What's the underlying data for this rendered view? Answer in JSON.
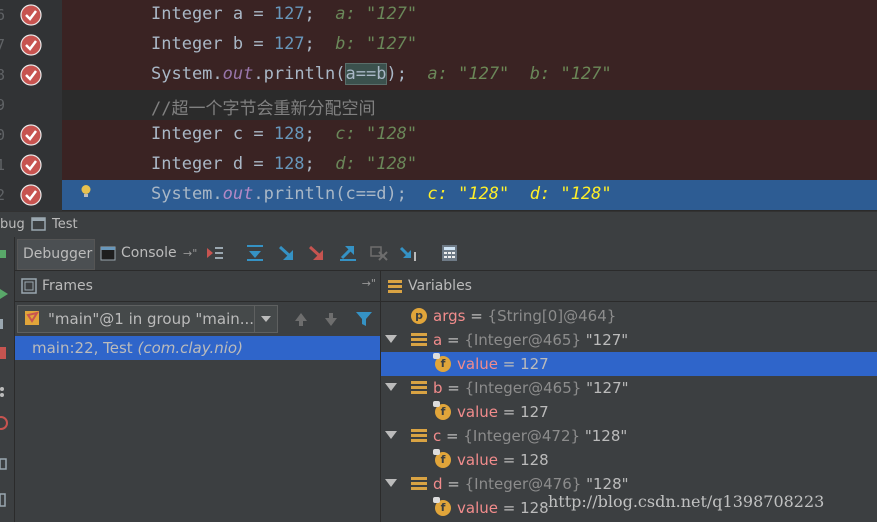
{
  "editor": {
    "lines": [
      {
        "num": "6",
        "code_parts": [
          [
            "Integer a = ",
            "kw"
          ],
          [
            "127",
            "num"
          ],
          [
            ";  ",
            "kw"
          ],
          [
            "a: \"127\"",
            "hint"
          ]
        ],
        "type": "bp"
      },
      {
        "num": "7",
        "code_parts": [
          [
            "Integer b = ",
            "kw"
          ],
          [
            "127",
            "num"
          ],
          [
            ";  ",
            "kw"
          ],
          [
            "b: \"127\"",
            "hint"
          ]
        ],
        "type": "bp"
      },
      {
        "num": "8",
        "code_parts": [
          [
            "System.",
            "kw"
          ],
          [
            "out",
            "field"
          ],
          [
            ".println(",
            "kw"
          ],
          [
            "a==b",
            "box"
          ],
          [
            ");  ",
            "kw"
          ],
          [
            "a: \"127\"  b: \"127\"",
            "hint"
          ]
        ],
        "type": "bp"
      },
      {
        "num": "9",
        "code_parts": [
          [
            "//超一个字节会重新分配空间",
            "cmt"
          ]
        ],
        "type": "comment"
      },
      {
        "num": "0",
        "code_parts": [
          [
            "Integer c = ",
            "kw"
          ],
          [
            "128",
            "num"
          ],
          [
            ";  ",
            "kw"
          ],
          [
            "c: \"128\"",
            "hint"
          ]
        ],
        "type": "bp"
      },
      {
        "num": "1",
        "code_parts": [
          [
            "Integer d = ",
            "kw"
          ],
          [
            "128",
            "num"
          ],
          [
            ";  ",
            "kw"
          ],
          [
            "d: \"128\"",
            "hint"
          ]
        ],
        "type": "bp"
      },
      {
        "num": "2",
        "code_parts": [
          [
            "System.",
            "kw"
          ],
          [
            "out",
            "field"
          ],
          [
            ".println(c==d);  ",
            "kw"
          ],
          [
            "c: \"128\"  d: \"128\"",
            "hint"
          ]
        ],
        "type": "current"
      }
    ]
  },
  "debug_title": {
    "prefix": "bug",
    "config": "Test"
  },
  "tabs": {
    "debugger": "Debugger",
    "console": "Console"
  },
  "frames": {
    "title": "Frames",
    "thread": "\"main\"@1 in group \"main...",
    "frame_text": "main:22, Test ",
    "frame_pkg": "(com.clay.nio)"
  },
  "variables": {
    "title": "Variables",
    "rows": [
      {
        "kind": "p",
        "name": "args",
        "type": "{String[0]@464}",
        "val": "",
        "indent": 0,
        "expand": false,
        "sel": false
      },
      {
        "kind": "obj",
        "name": "a",
        "type": "{Integer@465}",
        "val": "\"127\"",
        "indent": 0,
        "expand": true,
        "sel": false
      },
      {
        "kind": "f",
        "name": "value",
        "type": "",
        "val": "127",
        "indent": 1,
        "expand": false,
        "sel": true
      },
      {
        "kind": "obj",
        "name": "b",
        "type": "{Integer@465}",
        "val": "\"127\"",
        "indent": 0,
        "expand": true,
        "sel": false
      },
      {
        "kind": "f",
        "name": "value",
        "type": "",
        "val": "127",
        "indent": 1,
        "expand": false,
        "sel": false
      },
      {
        "kind": "obj",
        "name": "c",
        "type": "{Integer@472}",
        "val": "\"128\"",
        "indent": 0,
        "expand": true,
        "sel": false
      },
      {
        "kind": "f",
        "name": "value",
        "type": "",
        "val": "128",
        "indent": 1,
        "expand": false,
        "sel": false
      },
      {
        "kind": "obj",
        "name": "d",
        "type": "{Integer@476}",
        "val": "\"128\"",
        "indent": 0,
        "expand": true,
        "sel": false
      },
      {
        "kind": "f",
        "name": "value",
        "type": "",
        "val": "128",
        "indent": 1,
        "expand": false,
        "sel": false
      }
    ]
  },
  "watermark": "http://blog.csdn.net/q1398708223",
  "colors": {
    "breakpoint": "#c75450",
    "current_line": "#2d5c93",
    "selection": "#2f65ca"
  }
}
